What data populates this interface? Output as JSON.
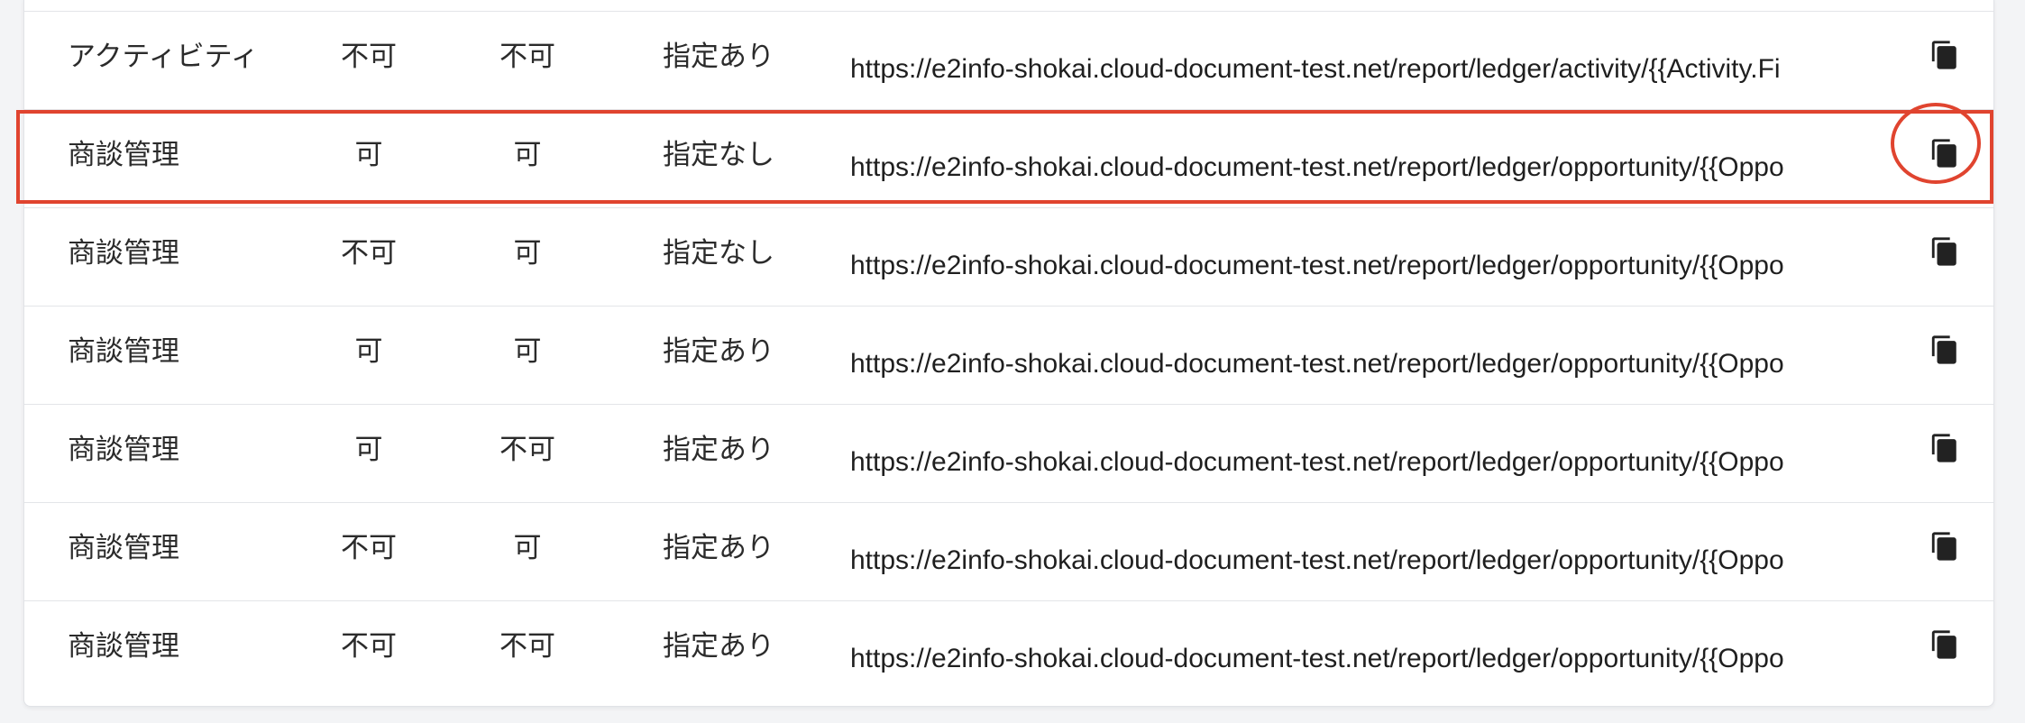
{
  "accent_color": "#e0442f",
  "rows": [
    {
      "name": "アクティビティ",
      "col_a": "不可",
      "col_b": "不可",
      "spec": "指定あり",
      "url": "https://e2info-shokai.cloud-document-test.net/report/ledger/activity/{{Activity.Fi",
      "copy_icon": "copy-icon"
    },
    {
      "name": "商談管理",
      "col_a": "可",
      "col_b": "可",
      "spec": "指定なし",
      "url": "https://e2info-shokai.cloud-document-test.net/report/ledger/opportunity/{{Oppo",
      "copy_icon": "copy-icon"
    },
    {
      "name": "商談管理",
      "col_a": "不可",
      "col_b": "可",
      "spec": "指定なし",
      "url": "https://e2info-shokai.cloud-document-test.net/report/ledger/opportunity/{{Oppo",
      "copy_icon": "copy-icon"
    },
    {
      "name": "商談管理",
      "col_a": "可",
      "col_b": "可",
      "spec": "指定あり",
      "url": "https://e2info-shokai.cloud-document-test.net/report/ledger/opportunity/{{Oppo",
      "copy_icon": "copy-icon"
    },
    {
      "name": "商談管理",
      "col_a": "可",
      "col_b": "不可",
      "spec": "指定あり",
      "url": "https://e2info-shokai.cloud-document-test.net/report/ledger/opportunity/{{Oppo",
      "copy_icon": "copy-icon"
    },
    {
      "name": "商談管理",
      "col_a": "不可",
      "col_b": "可",
      "spec": "指定あり",
      "url": "https://e2info-shokai.cloud-document-test.net/report/ledger/opportunity/{{Oppo",
      "copy_icon": "copy-icon"
    },
    {
      "name": "商談管理",
      "col_a": "不可",
      "col_b": "不可",
      "spec": "指定あり",
      "url": "https://e2info-shokai.cloud-document-test.net/report/ledger/opportunity/{{Oppo",
      "copy_icon": "copy-icon"
    }
  ]
}
